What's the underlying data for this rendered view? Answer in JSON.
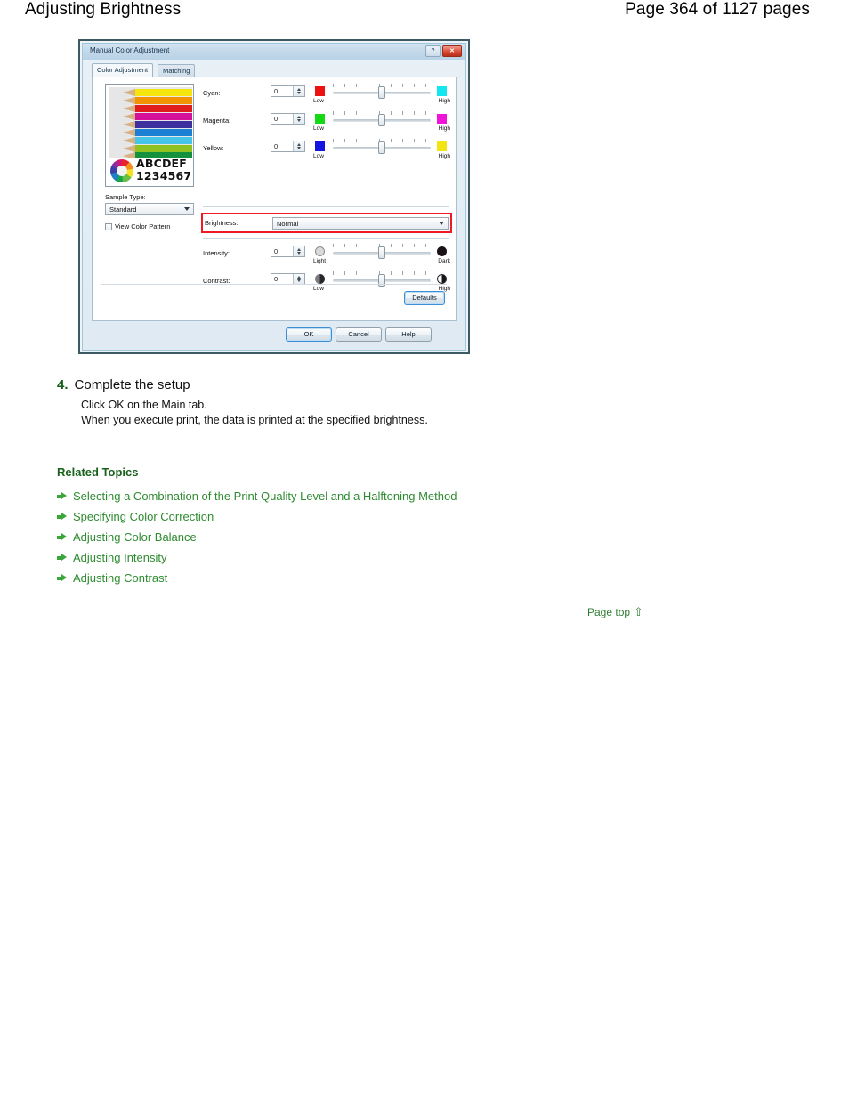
{
  "header": {
    "title": "Adjusting Brightness",
    "page_info": "Page 364 of 1127 pages"
  },
  "dialog": {
    "title": "Manual Color Adjustment",
    "titlebar_buttons": [
      {
        "name": "help-button",
        "glyph": "?"
      },
      {
        "name": "close-button",
        "glyph": "✕"
      }
    ],
    "tabs": [
      {
        "label": "Color Adjustment",
        "active": true
      },
      {
        "label": "Matching",
        "active": false
      }
    ],
    "preview": {
      "sample_line1": "ABCDEF",
      "sample_line2": "1234567"
    },
    "sample_type": {
      "label": "Sample Type:",
      "value": "Standard"
    },
    "view_color_pattern": {
      "label": "View Color Pattern",
      "checked": false
    },
    "color_rows": [
      {
        "label": "Cyan:",
        "value": "0",
        "low_label": "Low",
        "high_label": "High",
        "low_color": "#ee1111",
        "high_color": "#12e7f0"
      },
      {
        "label": "Magenta:",
        "value": "0",
        "low_label": "Low",
        "high_label": "High",
        "low_color": "#16d916",
        "high_color": "#f014d9"
      },
      {
        "label": "Yellow:",
        "value": "0",
        "low_label": "Low",
        "high_label": "High",
        "low_color": "#1414e0",
        "high_color": "#f2e312"
      }
    ],
    "brightness": {
      "label": "Brightness:",
      "value": "Normal",
      "highlight_color": "#ee1b24"
    },
    "tone_rows": [
      {
        "label": "Intensity:",
        "value": "0",
        "low_label": "Light",
        "high_label": "Dark",
        "low_icon": "light-circle-icon",
        "high_icon": "dark-circle-icon"
      },
      {
        "label": "Contrast:",
        "value": "0",
        "low_label": "Low",
        "high_label": "High",
        "low_icon": "half-circle-icon",
        "high_icon": "half-circle-icon"
      }
    ],
    "defaults_button": "Defaults",
    "footer_buttons": {
      "ok": "OK",
      "cancel": "Cancel",
      "help": "Help"
    }
  },
  "step": {
    "number": "4.",
    "title": "Complete the setup",
    "line1": "Click OK on the Main tab.",
    "line2": "When you execute print, the data is printed at the specified brightness."
  },
  "related": {
    "heading": "Related Topics",
    "items": [
      {
        "label": "Selecting a Combination of the Print Quality Level and a Halftoning Method"
      },
      {
        "label": "Specifying Color Correction"
      },
      {
        "label": "Adjusting Color Balance"
      },
      {
        "label": "Adjusting Intensity"
      },
      {
        "label": "Adjusting Contrast"
      }
    ]
  },
  "page_top": {
    "label": "Page top",
    "arrow": "⇧"
  }
}
